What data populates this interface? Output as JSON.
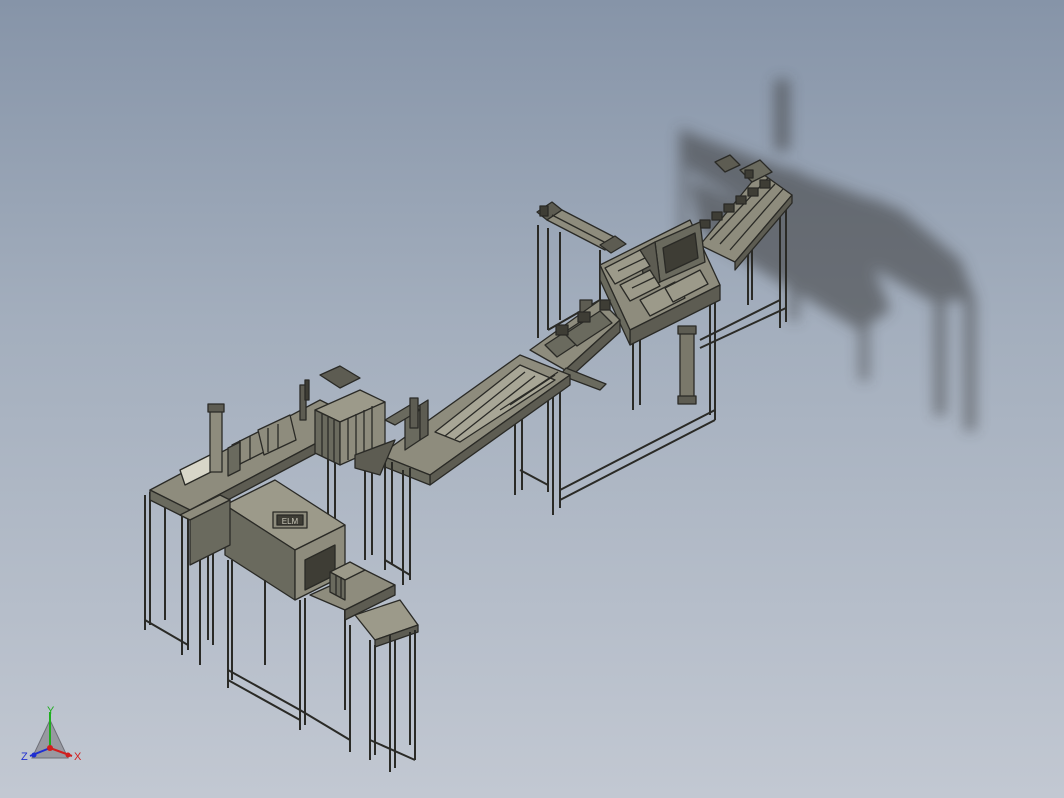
{
  "viewport": {
    "background_top": "#8694a8",
    "background_bottom": "#c2c8d2",
    "model_color": "#7a786a",
    "model_edge_color": "#2a2a26"
  },
  "model": {
    "icon": "conveyor-line-assembly",
    "panel_label": "ELM"
  },
  "triad": {
    "x_label": "X",
    "y_label": "Y",
    "z_label": "Z",
    "x_color": "#d11f1f",
    "y_color": "#1fae1f",
    "z_color": "#1f2fd1"
  }
}
